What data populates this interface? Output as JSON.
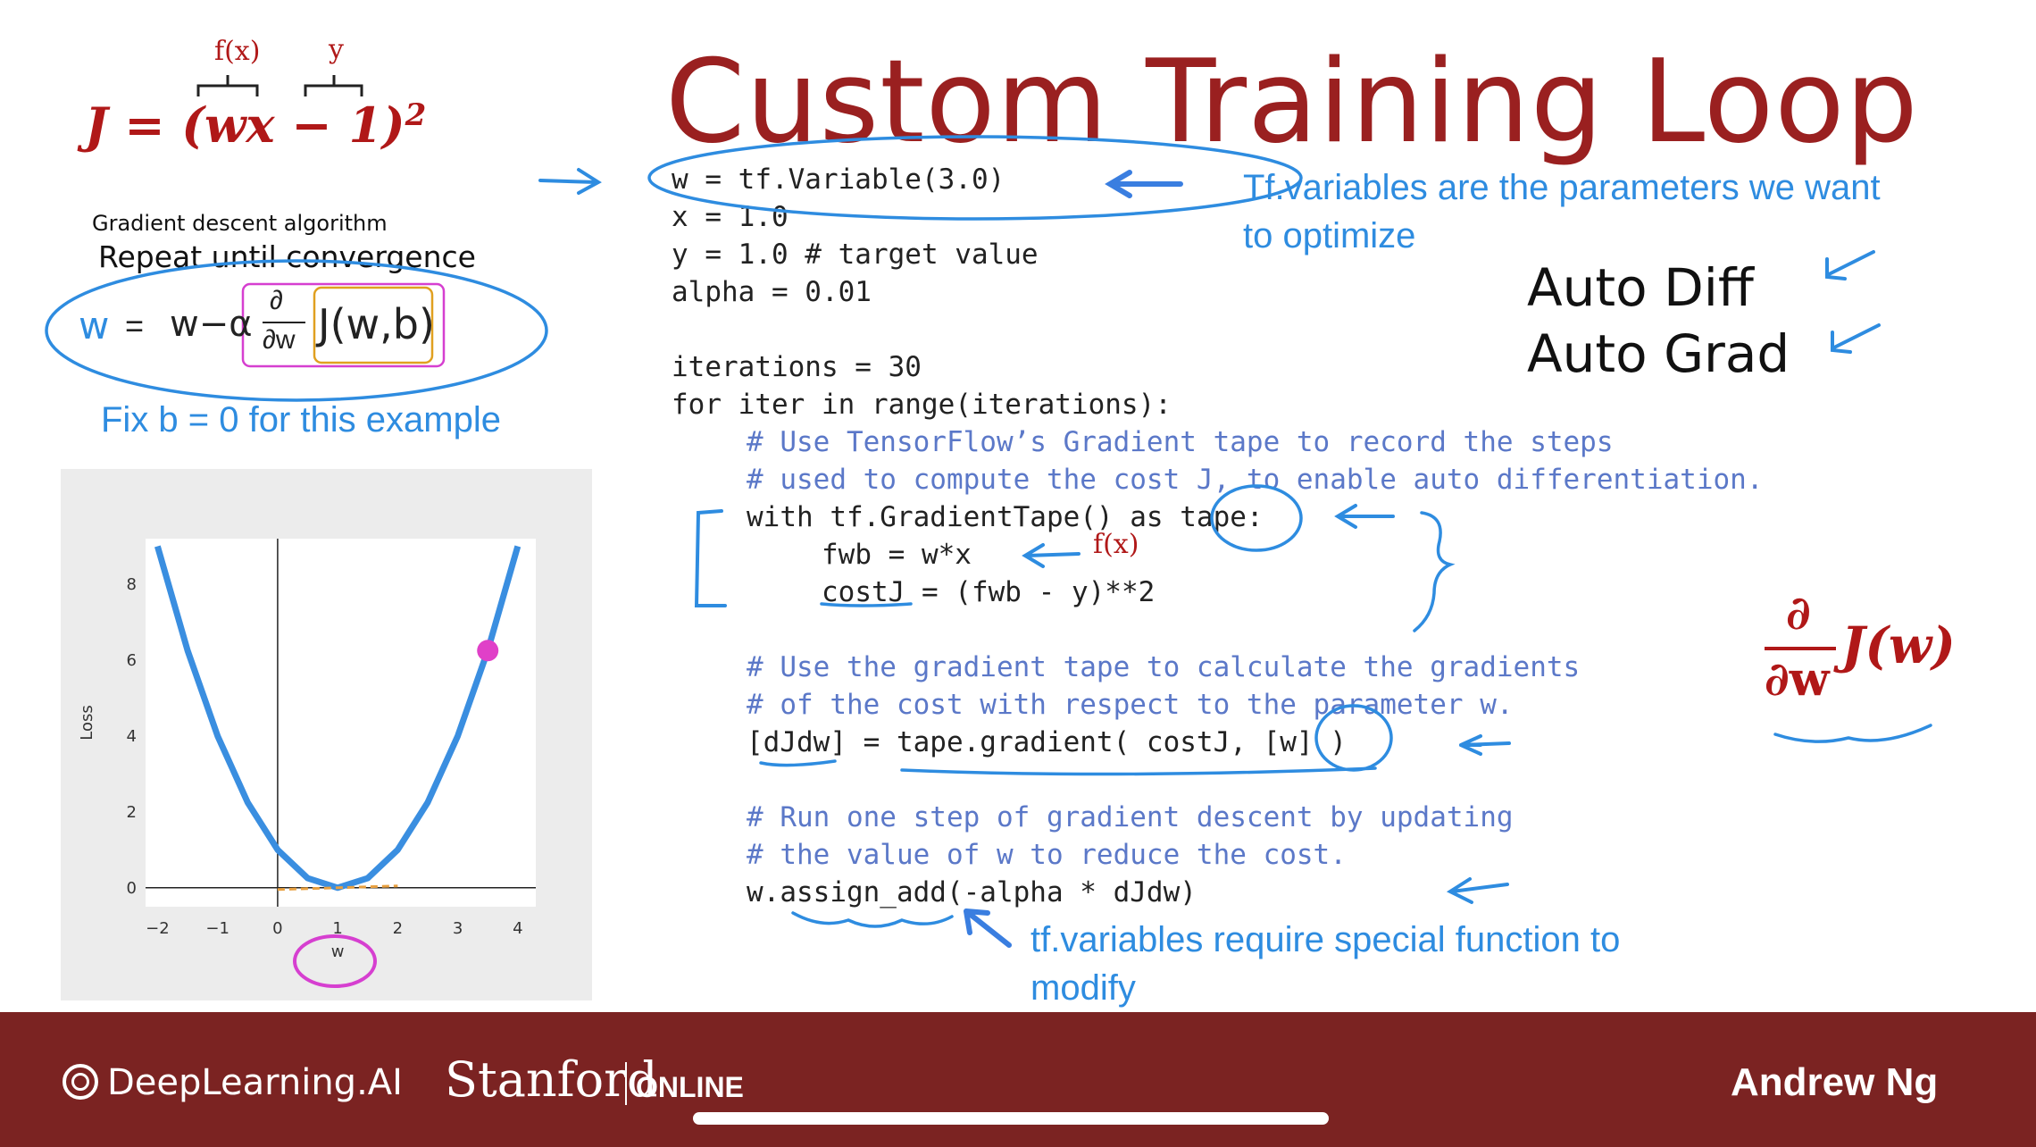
{
  "slide": {
    "title": "Custom Training Loop",
    "equation": {
      "lhs": "J = (wx − 1)",
      "exponent": "2",
      "annot_fx": "f(x)",
      "annot_y": "y"
    },
    "gradient_descent": {
      "heading": "Gradient descent algorithm",
      "repeat": "Repeat until convergence",
      "w": "w",
      "eq": "=",
      "w_minus_alpha": "w−α",
      "partial_num": "∂",
      "partial_den": "∂w",
      "J_wb": "J(w,b)"
    },
    "fix_b_note": "Fix b = 0 for this example",
    "code": {
      "line1": "w = tf.Variable(3.0)",
      "line2": "x = 1.0",
      "line3": "y = 1.0 # target value",
      "line4": "alpha = 0.01",
      "line5": "iterations = 30",
      "line6": "for iter in range(iterations):",
      "c1": "# Use TensorFlow’s Gradient tape to record the steps",
      "c2": "# used to compute the cost J, to enable auto differentiation.",
      "line7": "with tf.GradientTape() as tape:",
      "line8": "fwb = w*x",
      "line9": "costJ = (fwb - y)**2",
      "c3": "# Use the gradient tape to calculate the gradients",
      "c4": "# of the cost with respect to the parameter w.",
      "line10": "[dJdw] = tape.gradient( costJ, [w] )",
      "c5": "# Run one step of gradient descent by updating",
      "c6": "# the value of w to reduce the cost.",
      "line11": "w.assign_add(-alpha * dJdw)"
    },
    "notes": {
      "tf_variables_1": "Tf.variables are the parameters we want",
      "tf_variables_2": "to optimize",
      "auto_diff": "Auto Diff",
      "auto_grad": "Auto Grad",
      "special_1": "tf.variables require special function to",
      "special_2": "modify",
      "fx_annot": "f(x)",
      "dj_num": "∂",
      "dj_den": "∂w",
      "dj_J": "J(w)"
    },
    "footer": {
      "brand": "DeepLearning.AI",
      "stanford": "Stanford",
      "online": "ONLINE",
      "presenter": "Andrew Ng"
    },
    "colors": {
      "title": "#9a2020",
      "annotation_blue": "#2e8ce0",
      "annotation_magenta": "#d63fd0",
      "footer_bg": "#7b2322"
    }
  },
  "chart_data": {
    "type": "line",
    "title": "",
    "xlabel": "w",
    "ylabel": "Loss",
    "xlim": [
      -2.2,
      4.3
    ],
    "ylim": [
      -0.5,
      9.2
    ],
    "xticks": [
      -2,
      -1,
      0,
      1,
      2,
      3,
      4
    ],
    "yticks": [
      0,
      2,
      4,
      6,
      8
    ],
    "series": [
      {
        "x": [
          -2,
          -1.5,
          -1,
          -0.5,
          0,
          0.5,
          1,
          1.5,
          2,
          2.5,
          3,
          3.5,
          4
        ],
        "y": [
          9,
          6.25,
          4,
          2.25,
          1,
          0.25,
          0,
          0.25,
          1,
          2.25,
          4,
          6.25,
          9
        ]
      }
    ],
    "marker_point": {
      "x": 3.5,
      "y": 6.25
    },
    "grid": false
  }
}
